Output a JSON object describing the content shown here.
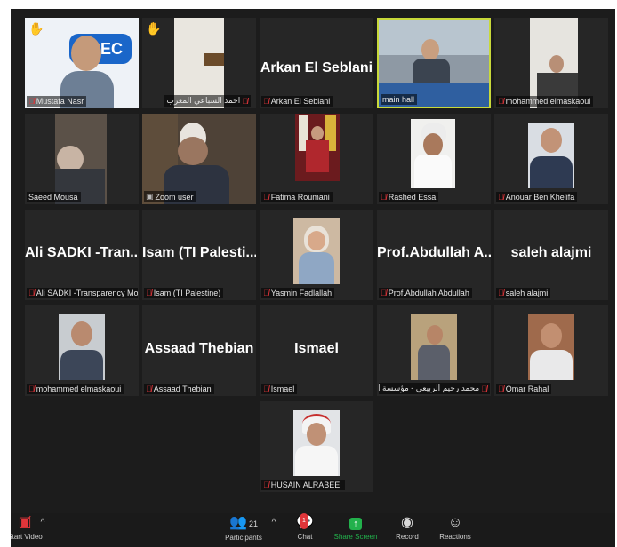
{
  "participants": [
    {
      "label": "Mustafa Nasr",
      "muted": true,
      "hand": true,
      "video": "ecec-backdrop"
    },
    {
      "label": "احمد السباعي  المغرب",
      "muted": true,
      "hand": true,
      "video": "room"
    },
    {
      "label": "Arkan El Seblani",
      "muted": true,
      "display_name": "Arkan El Seblani"
    },
    {
      "label": "main hall",
      "muted": false,
      "active": true,
      "video": "hall"
    },
    {
      "label": "mohammed elmaskaoui",
      "muted": true,
      "video": "room"
    },
    {
      "label": "Saeed Mousa",
      "muted": false,
      "video": "room"
    },
    {
      "label": "Zoom user",
      "muted": false,
      "video": "room"
    },
    {
      "label": "Fatima Roumani",
      "muted": true,
      "video": "flags"
    },
    {
      "label": "Rashed Essa",
      "muted": true,
      "video": "portrait"
    },
    {
      "label": "Anouar Ben Khelifa",
      "muted": true,
      "video": "portrait"
    },
    {
      "label": "Ali SADKI -Transparency Mo...",
      "muted": true,
      "display_name": "Ali SADKI -Tran..."
    },
    {
      "label": "Isam (TI Palestine)",
      "muted": true,
      "display_name": "Isam (TI Palesti..."
    },
    {
      "label": "Yasmin Fadlallah",
      "muted": true,
      "video": "portrait"
    },
    {
      "label": "Prof.Abdullah Abdullah",
      "muted": true,
      "display_name": "Prof.Abdullah A..."
    },
    {
      "label": "saleh alajmi",
      "muted": true,
      "display_name": "saleh alajmi"
    },
    {
      "label": "mohammed elmaskaoui",
      "muted": true,
      "video": "portrait"
    },
    {
      "label": "Assaad Thebian",
      "muted": true,
      "display_name": "Assaad Thebian"
    },
    {
      "label": "Ismael",
      "muted": true,
      "display_name": "Ismael"
    },
    {
      "label": "محمد رحيم الربيعي - مؤسسة ا...",
      "muted": true,
      "video": "portrait"
    },
    {
      "label": "Omar Rahal",
      "muted": true,
      "video": "portrait"
    },
    {
      "label": "HUSAIN ALRABEEI",
      "muted": true,
      "video": "portrait"
    }
  ],
  "toolbar": {
    "start_video": "Start Video",
    "participants": "Participants",
    "participants_count": "21",
    "chat": "Chat",
    "chat_badge": "1",
    "share_screen": "Share Screen",
    "record": "Record",
    "reactions": "Reactions"
  },
  "colors": {
    "background": "#1c1c1c",
    "tile": "#262626",
    "active_border": "#c8d93a",
    "muted_icon": "#e0353a",
    "share": "#22b14c"
  }
}
